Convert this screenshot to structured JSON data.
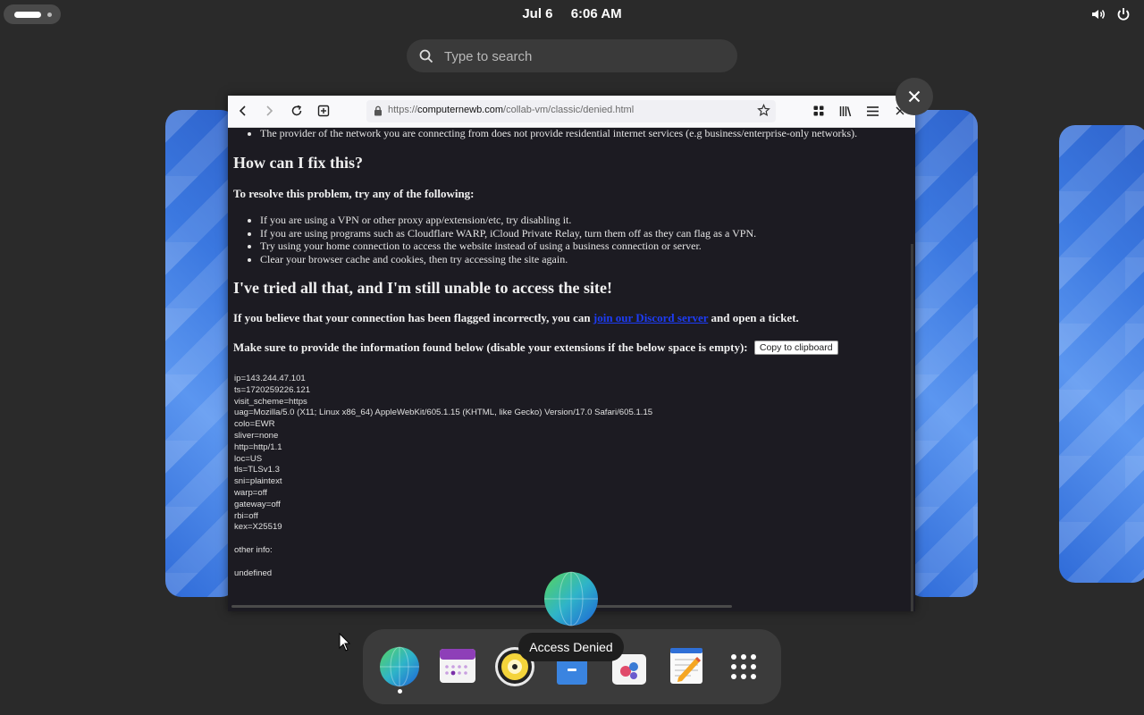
{
  "topbar": {
    "date": "Jul 6",
    "time": "6:06 AM",
    "icons": [
      "activities-indicator",
      "volume-icon",
      "power-icon"
    ]
  },
  "search": {
    "placeholder": "Type to search"
  },
  "browser": {
    "url_prefix": "https://",
    "url_host": "computernewb.com",
    "url_path": "/collab-vm/classic/denied.html",
    "page": {
      "top_bullet": "The provider of the network you are connecting from does not provide residential internet services (e.g business/enterprise-only networks).",
      "h_fix": "How can I fix this?",
      "resolve_intro": "To resolve this problem, try any of the following:",
      "fixes": [
        "If you are using a VPN or other proxy app/extension/etc, try disabling it.",
        "If you are using programs such as Cloudflare WARP, iCloud Private Relay, turn them off as they can flag as a VPN.",
        "Try using your home connection to access the website instead of using a business connection or server.",
        "Clear your browser cache and cookies, then try accessing the site again."
      ],
      "h_tried": "I've tried all that, and I'm still unable to access the site!",
      "flagged_before": "If you believe that your connection has been flagged incorrectly, you can",
      "flagged_link": "join our Discord server",
      "flagged_after": "and open a ticket.",
      "provide_info": "Make sure to provide the information found below (disable your extensions if the below space is empty):",
      "copy_button": "Copy to clipboard",
      "info_lines": [
        "ip=143.244.47.101",
        "ts=1720259226.121",
        "visit_scheme=https",
        "uag=Mozilla/5.0 (X11; Linux x86_64) AppleWebKit/605.1.15 (KHTML, like Gecko) Version/17.0 Safari/605.1.15",
        "colo=EWR",
        "sliver=none",
        "http=http/1.1",
        "loc=US",
        "tls=TLSv1.3",
        "sni=plaintext",
        "warp=off",
        "gateway=off",
        "rbi=off",
        "kex=X25519",
        "",
        "other info:",
        "",
        "undefined"
      ]
    }
  },
  "tooltip": "Access Denied",
  "dash": {
    "apps": [
      "web-browser-icon",
      "calendar-icon",
      "rhythmbox-icon",
      "software-icon",
      "flatpak-store-icon",
      "text-editor-icon",
      "app-grid-icon"
    ]
  }
}
